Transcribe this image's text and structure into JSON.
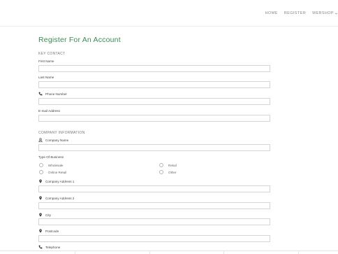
{
  "nav": {
    "items": [
      {
        "label": "HOME"
      },
      {
        "label": "REGISTER"
      },
      {
        "label": "WEBSHOP"
      }
    ]
  },
  "page": {
    "title": "Register For An Account"
  },
  "key_contact": {
    "heading": "KEY CONTACT",
    "first_name": "First Name",
    "last_name": "Last Name",
    "phone": "Phone Number",
    "email": "E-mail Address"
  },
  "company": {
    "heading": "COMPANY INFORMATION",
    "name": "Company Name",
    "type_label": "Type Of Business",
    "types": [
      {
        "label": "Wholesale"
      },
      {
        "label": "Retail"
      },
      {
        "label": "Online Retail"
      },
      {
        "label": "Other"
      }
    ],
    "address1": "Company Address 1",
    "address2": "Company Address 2",
    "city": "City",
    "postcode": "Postcode",
    "telephone": "Telephone"
  },
  "colors": {
    "title": "#3c8a52",
    "input_border": "#d5d5d5"
  }
}
